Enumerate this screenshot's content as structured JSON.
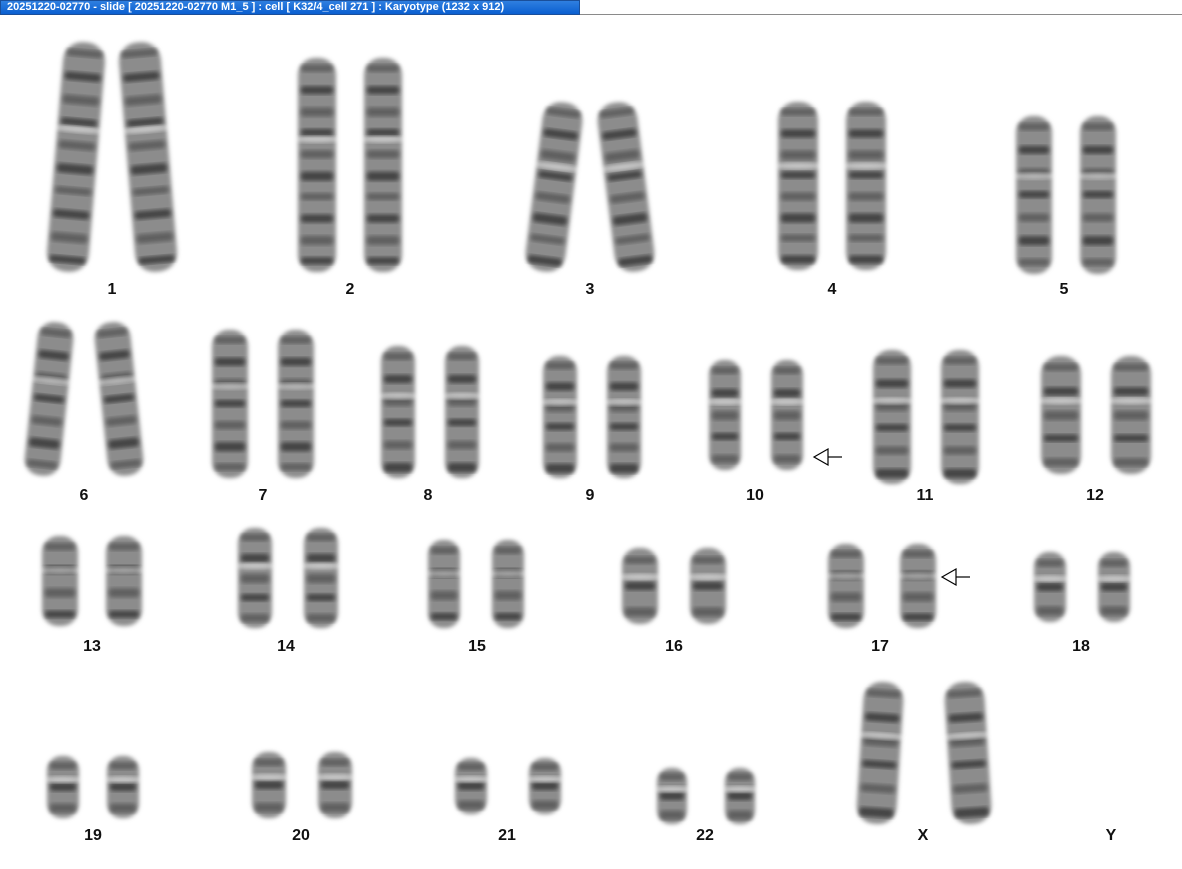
{
  "window": {
    "title": "20251220-02770 - slide [ 20251220-02770 M1_5 ] : cell [ K32/4_cell 271 ] : Karyotype  (1232 x 912)"
  },
  "karyotype": {
    "labels": [
      "1",
      "2",
      "3",
      "4",
      "5",
      "6",
      "7",
      "8",
      "9",
      "10",
      "11",
      "12",
      "13",
      "14",
      "15",
      "16",
      "17",
      "18",
      "19",
      "20",
      "21",
      "22",
      "X",
      "Y"
    ],
    "arrows": [
      "chr10-right",
      "chr17-right"
    ]
  }
}
